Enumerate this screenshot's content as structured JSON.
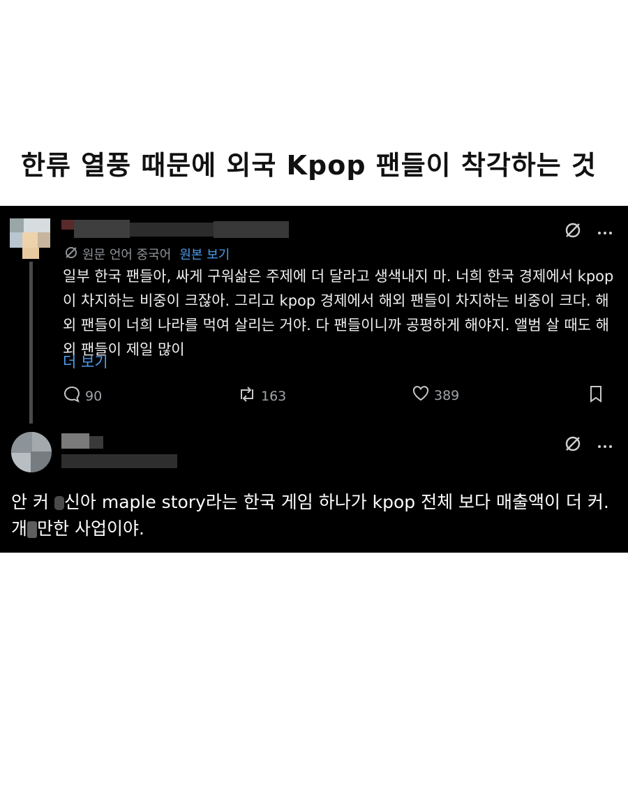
{
  "headline": "한류 열풍 때문에 외국 Kpop 팬들이 착각하는 것",
  "post": {
    "translation": {
      "label": "원문 언어 중국어",
      "link": "원본 보기"
    },
    "body": "일부 한국 팬들아, 싸게 구워삶은 주제에 더 달라고 생색내지 마. 너희 한국 경제에서 kpop이 차지하는 비중이 크잖아. 그리고 kpop 경제에서 해외 팬들이 차지하는 비중이 크다. 해외 팬들이 너희 나라를 먹여 살리는 거야. 다 팬들이니까 공평하게 해야지. 앨범 살 때도 해외 팬들이 제일 많이",
    "more": "더 보기",
    "actions": {
      "replies": "90",
      "reposts": "163",
      "likes": "389"
    }
  },
  "reply": {
    "text_part1": "안 커",
    "text_part2": "신아 maple story라는 한국 게임 하나가 kpop 전체 보다 매출액이 더 커.",
    "text_part3": "개",
    "text_part4": "만한 사업이야."
  },
  "icons": [
    "translate-off-icon",
    "more-options-icon",
    "translate-icon",
    "reply-icon",
    "repost-icon",
    "like-icon",
    "bookmark-icon"
  ],
  "colors": {
    "panel_background": "#000000",
    "link": "#4c9ded",
    "muted": "#a0a4a8"
  }
}
